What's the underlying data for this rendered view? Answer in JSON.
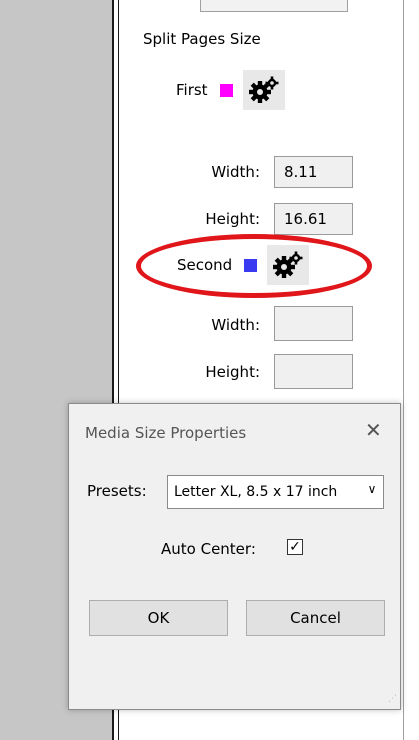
{
  "panel": {
    "section_title": "Split Pages Size",
    "first": {
      "label": "First",
      "color": "#ff00ff",
      "width_label": "Width:",
      "width_value": "8.11",
      "height_label": "Height:",
      "height_value": "16.61"
    },
    "second": {
      "label": "Second",
      "color": "#3a3af0",
      "width_label": "Width:",
      "width_value": "",
      "height_label": "Height:",
      "height_value": ""
    },
    "gear_icon": "gears-icon",
    "highlight_color": "#e0161a"
  },
  "dialog": {
    "title": "Media Size Properties",
    "close_glyph": "✕",
    "presets_label": "Presets:",
    "presets_value": "Letter XL, 8.5 x 17 inch",
    "auto_center_label": "Auto Center:",
    "auto_center_checked": true,
    "ok_label": "OK",
    "cancel_label": "Cancel"
  }
}
